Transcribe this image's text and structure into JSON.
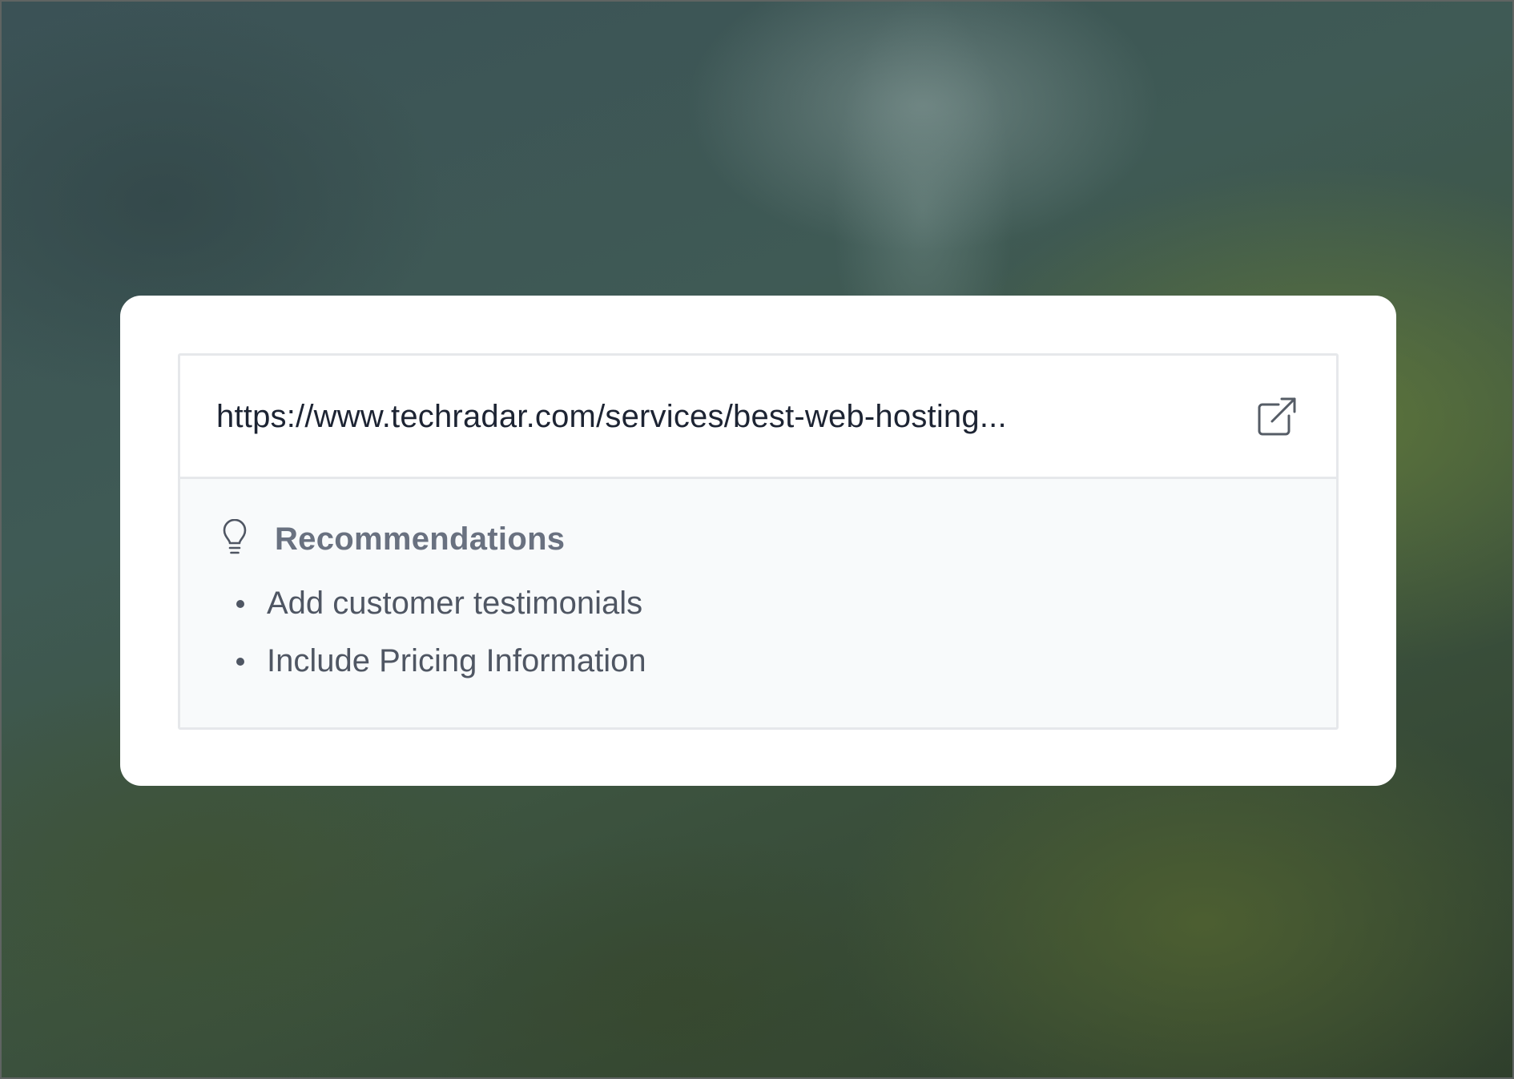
{
  "link_card": {
    "url": "https://www.techradar.com/services/best-web-hosting...",
    "open_icon": "external-link-icon"
  },
  "recommendations": {
    "icon": "lightbulb-icon",
    "title": "Recommendations",
    "items": [
      "Add customer testimonials",
      "Include Pricing Information"
    ]
  },
  "colors": {
    "card_background": "#ffffff",
    "panel_background": "#f8fafb",
    "url_text": "#1d2433",
    "heading_text": "#697180",
    "body_text": "#4f5663"
  }
}
